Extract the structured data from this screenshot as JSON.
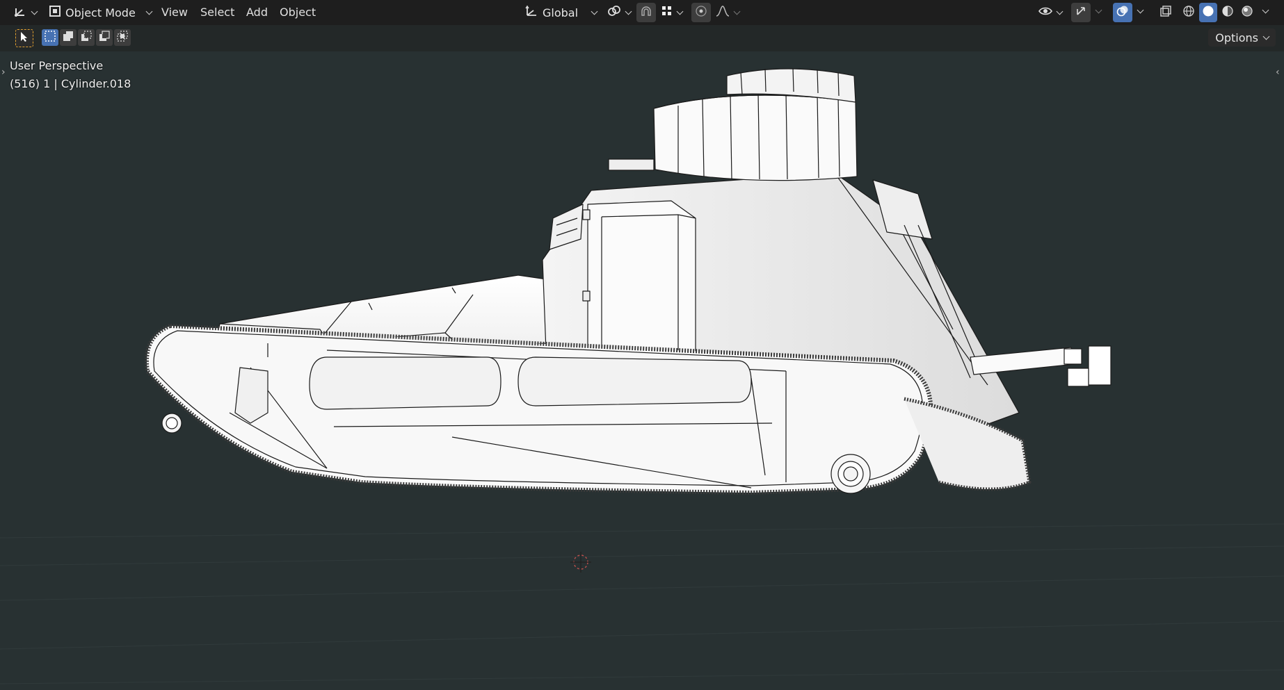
{
  "header": {
    "editor_type_icon": "axes-icon",
    "mode": {
      "label": "Object Mode",
      "icon": "object-mode-icon"
    },
    "menus": [
      "View",
      "Select",
      "Add",
      "Object"
    ],
    "transform_orientation": {
      "label": "Global",
      "icon": "global-orientation-icon"
    },
    "pivot_icon": "pivot-link-icon",
    "snap_icon": "magnet-icon",
    "snap_target_icon": "snap-grid-icon",
    "proportional_icon": "proportional-edit-icon",
    "falloff_icon": "falloff-curve-icon",
    "visibility_icon": "eye-icon",
    "gizmo_icon": "gizmo-icon",
    "overlay_icon": "overlay-icon",
    "xray_icon": "xray-icon",
    "shading_modes": [
      "wireframe-shading-icon",
      "solid-shading-icon",
      "material-shading-icon",
      "rendered-shading-icon"
    ],
    "active_shading": "solid-shading-icon"
  },
  "toolbar": {
    "tool_icon": "select-cursor-icon",
    "selection_modes": [
      "new-selection-icon",
      "extend-selection-icon",
      "subtract-selection-icon",
      "invert-selection-icon",
      "intersect-selection-icon"
    ],
    "options_label": "Options"
  },
  "viewport": {
    "view_name": "User Perspective",
    "object_info": "(516) 1 | Cylinder.018",
    "background_color": "#283132",
    "object": "tank-model"
  }
}
